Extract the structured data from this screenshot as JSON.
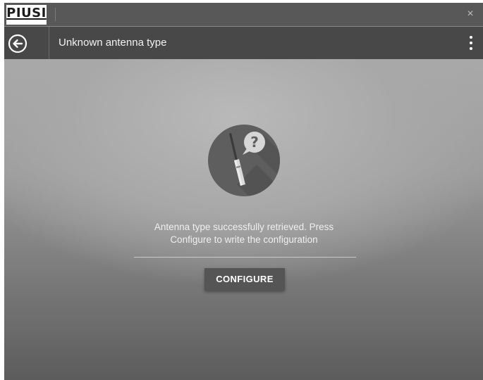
{
  "titlebar": {
    "logo_text": "PIUSI",
    "close_glyph": "×"
  },
  "header": {
    "title": "Unknown antenna type",
    "back_icon": "back-arrow-circle-icon",
    "menu_icon": "more-vertical-icon"
  },
  "main": {
    "illustration_icon": "antenna-question-icon",
    "message_line1": "Antenna type successfully retrieved. Press",
    "message_line2": "Configure to write the configuration",
    "configure_label": "CONFIGURE"
  },
  "colors": {
    "titlebar_bg": "#585858",
    "appbar_bg": "#484848",
    "button_bg": "#555555",
    "illustration_circle": "#5e5e5e"
  }
}
